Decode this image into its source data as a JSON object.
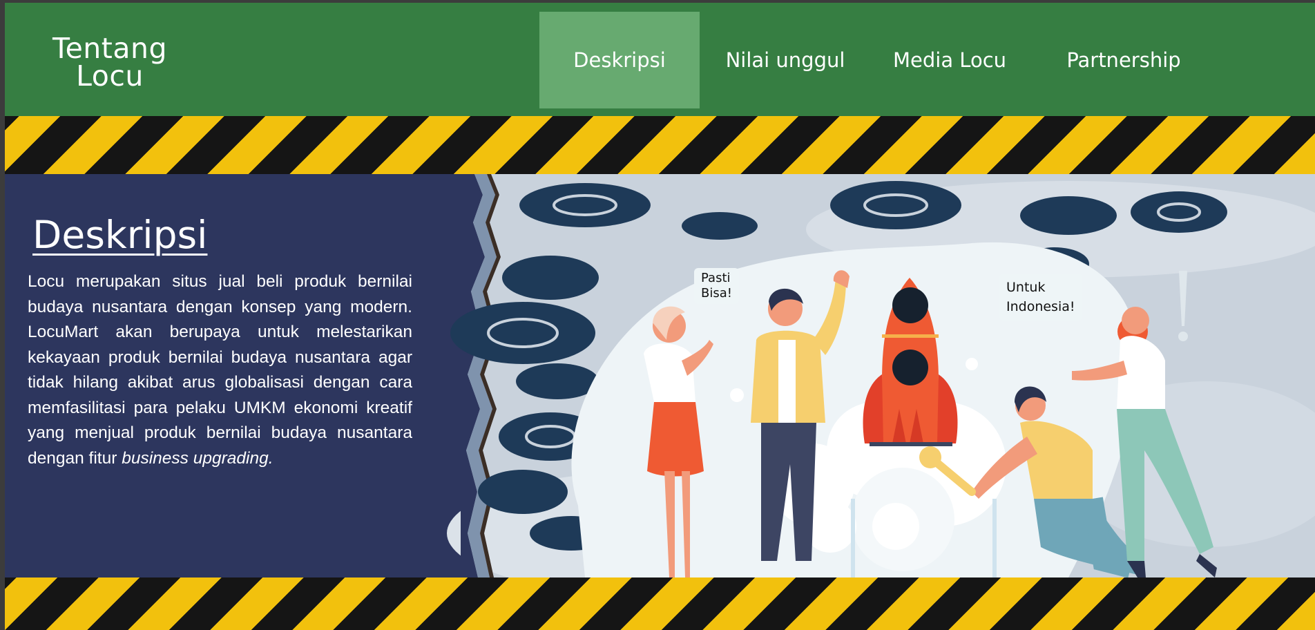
{
  "header": {
    "logo_line1": "Tentang",
    "logo_line2": "Locu",
    "nav": [
      {
        "label": "Deskripsi",
        "active": true
      },
      {
        "label": "Nilai unggul"
      },
      {
        "label": "Media Locu"
      },
      {
        "label": "Partnership"
      }
    ]
  },
  "section": {
    "title": "Deskripsi",
    "description": "Locu merupakan situs jual beli produk bernilai budaya nusantara dengan konsep yang modern. LocuMart akan berupaya untuk melestarikan kekayaan produk bernilai budaya nusantara agar tidak hilang akibat arus globalisasi dengan cara memfasilitasi para pelaku UMKM ekonomi kreatif yang menjual produk bernilai budaya nusantara dengan fitur",
    "description_em": "business upgrading."
  },
  "illustration": {
    "bubble_left": [
      "Pasti",
      "Bisa!"
    ],
    "bubble_right": [
      "Untuk",
      "Indonesia!"
    ]
  },
  "colors": {
    "header_green": "#367e42",
    "nav_active": "#67aa70",
    "panel_navy": "#2d365e",
    "stripe_yellow": "#f2c10d",
    "rocket_orange": "#ef5a33"
  }
}
